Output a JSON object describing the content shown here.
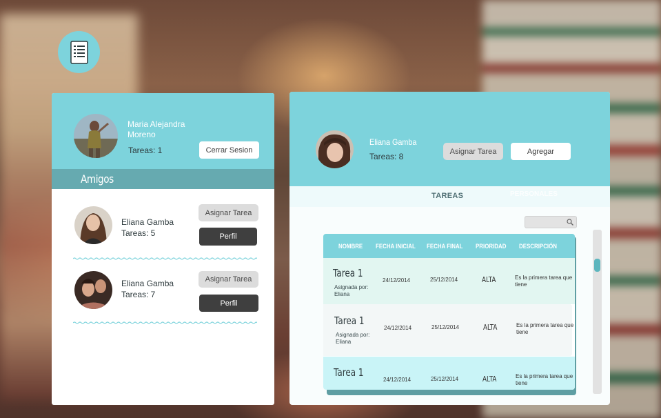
{
  "app": {
    "logo_icon": "document-list-icon"
  },
  "colors": {
    "accent": "#7dd3dc",
    "accent_dark": "#66aab0",
    "button_dark": "#3f3f3f"
  },
  "current_user": {
    "name": "Maria Alejandra Moreno",
    "tasks": "Tareas: 1",
    "logout_label": "Cerrar Sesion"
  },
  "friends_section": {
    "title": "Amigos",
    "friends": [
      {
        "name": "Eliana Gamba",
        "tasks": "Tareas: 5",
        "assign_label": "Asignar Tarea",
        "profile_label": "Perfil"
      },
      {
        "name": "Eliana Gamba",
        "tasks": "Tareas: 7",
        "assign_label": "Asignar Tarea",
        "profile_label": "Perfil"
      }
    ]
  },
  "selected_friend": {
    "name": "Eliana Gamba",
    "tasks": "Tareas: 8",
    "assign_label": "Asignar Tarea",
    "add_label": "Agregar"
  },
  "tabs": {
    "active": "TAREAS",
    "other": "PERSONALES"
  },
  "search": {
    "icon": "search-icon",
    "value": ""
  },
  "table": {
    "headers": [
      "NOMBRE",
      "FECHA INICIAL",
      "FECHA FINAL",
      "PRIORIDAD",
      "DESCRIPCIÓN"
    ],
    "rows": [
      {
        "name": "Tarea 1",
        "assigned": "Asignada por: Eliana",
        "start": "24/12/2014",
        "end": "25/12/2014",
        "priority": "ALTA",
        "description": "Es la primera tarea que tiene"
      },
      {
        "name": "Tarea 1",
        "assigned": "Asignada por: Eliana",
        "start": "24/12/2014",
        "end": "25/12/2014",
        "priority": "ALTA",
        "description": "Es la primera tarea que tiene"
      },
      {
        "name": "Tarea 1",
        "assigned": "",
        "start": "24/12/2014",
        "end": "25/12/2014",
        "priority": "ALTA",
        "description": "Es la primera tarea que tiene"
      }
    ]
  }
}
